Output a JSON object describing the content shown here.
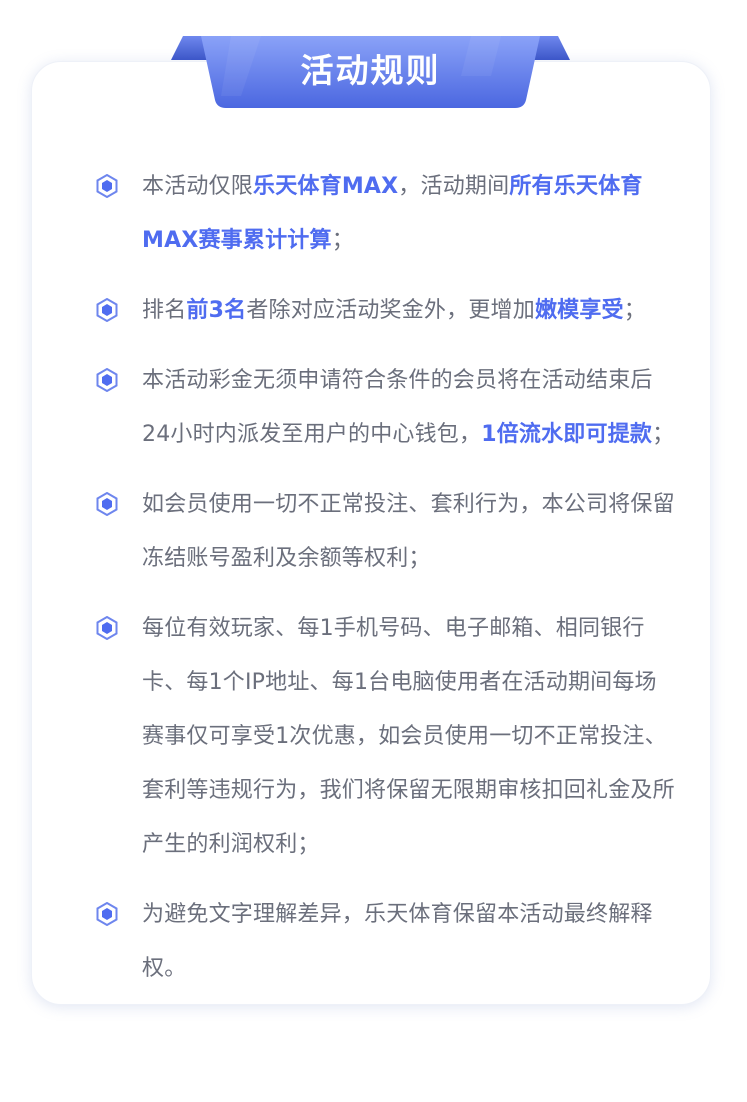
{
  "header": {
    "title": "活动规则"
  },
  "colors": {
    "accent": "#4f6cf0",
    "banner_light": "#8aa2f8",
    "banner_dark": "#4b67e0",
    "text": "#6b6f7c",
    "card_bg": "#ffffff"
  },
  "rules": [
    {
      "icon": "hexagon-bullet-icon",
      "p1": "本活动仅限",
      "h1": "乐天体育MAX",
      "p2": "，活动期间",
      "h2": "所有乐天体育MAX赛事累计计算",
      "p3": "；"
    },
    {
      "icon": "hexagon-bullet-icon",
      "p1": "排名",
      "h1": "前3名",
      "p2": "者除对应活动奖金外，更增加",
      "h2": "嫩模享受",
      "p3": "；"
    },
    {
      "icon": "hexagon-bullet-icon",
      "p1": "本活动彩金无须申请符合条件的会员将在活动结束后24小时内派发至用户的中心钱包，",
      "h1": "1倍流水即可提款",
      "p2": "；"
    },
    {
      "icon": "hexagon-bullet-icon",
      "text": "如会员使用一切不正常投注、套利行为，本公司将保留冻结账号盈利及余额等权利；"
    },
    {
      "icon": "hexagon-bullet-icon",
      "text": "每位有效玩家、每1手机号码、电子邮箱、相同银行卡、每1个IP地址、每1台电脑使用者在活动期间每场赛事仅可享受1次优惠，如会员使用一切不正常投注、套利等违规行为，我们将保留无限期审核扣回礼金及所产生的利润权利；"
    },
    {
      "icon": "hexagon-bullet-icon",
      "text": "为避免文字理解差异，乐天体育保留本活动最终解释权。"
    }
  ]
}
